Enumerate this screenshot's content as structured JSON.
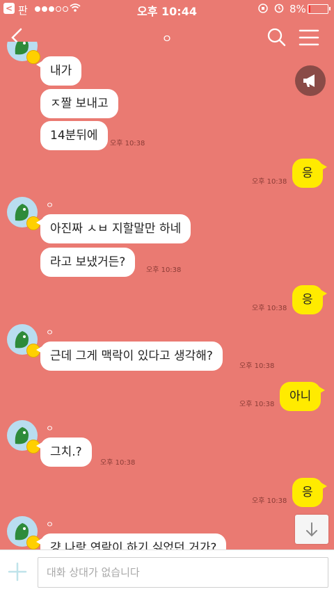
{
  "status_bar": {
    "back_app_label": "<",
    "carrier": "판",
    "time": "오후 10:44",
    "battery_percent": "8%",
    "battery_level": 0.08,
    "signal_bars_filled": 3,
    "signal_bars_total": 5
  },
  "nav": {
    "title": "ㅇ"
  },
  "messages": [
    {
      "text": "내가",
      "kind": "other",
      "ts": ""
    },
    {
      "text": "ㅈ짤 보내고",
      "kind": "other",
      "ts": ""
    },
    {
      "text": "14분뒤에",
      "kind": "other",
      "ts": "오후 10:38"
    },
    {
      "text": "응",
      "kind": "mine",
      "ts": "오후 10:38"
    },
    {
      "sender": "ㅇ",
      "text": "아진짜 ㅅㅂ 지할말만 하네",
      "kind": "other",
      "ts": ""
    },
    {
      "text": "라고 보냈거든?",
      "kind": "other",
      "ts": "오후 10:38"
    },
    {
      "text": "응",
      "kind": "mine",
      "ts": "오후 10:38"
    },
    {
      "sender": "ㅇ",
      "text": "근데 그게 맥락이 있다고 생각해?",
      "kind": "other",
      "ts": "오후 10:38"
    },
    {
      "text": "아니",
      "kind": "mine",
      "ts": "오후 10:38"
    },
    {
      "sender": "ㅇ",
      "text": "그치.?",
      "kind": "other",
      "ts": "오후 10:38"
    },
    {
      "text": "응",
      "kind": "mine",
      "ts": "오후 10:38"
    },
    {
      "sender": "ㅇ",
      "text": "걍 나랑 연락이 하기 싫었던 거가?",
      "kind": "other",
      "ts": ""
    }
  ],
  "input": {
    "placeholder": "대화 상대가 없습니다"
  },
  "colors": {
    "background": "#ea7a72",
    "my_bubble": "#ffeb00",
    "other_bubble": "#ffffff",
    "battery_low": "#ff2a2a"
  },
  "icons": [
    "back-icon",
    "search-icon",
    "menu-icon",
    "megaphone-icon",
    "arrow-down-icon",
    "plus-icon",
    "wifi-icon",
    "alarm-icon",
    "rotation-lock-icon"
  ]
}
